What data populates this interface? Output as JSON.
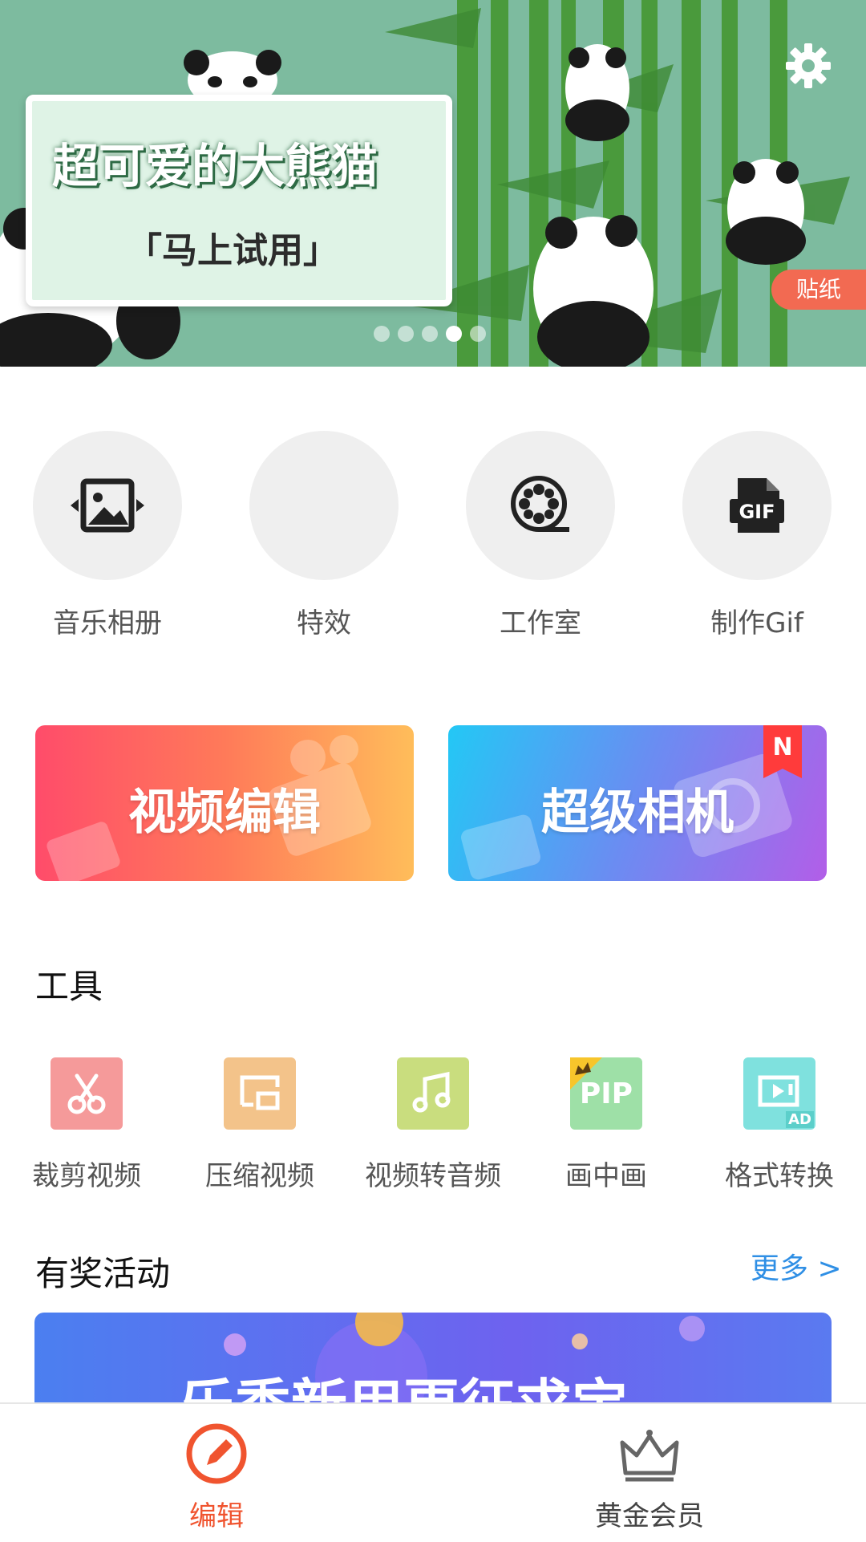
{
  "banner": {
    "title": "超可爱的大熊猫",
    "subtitle": "「马上试用」",
    "tag": "贴纸",
    "settings_icon": "gear-icon",
    "page_count": 5,
    "active_page": 4
  },
  "quick_actions": [
    {
      "label": "音乐相册",
      "icon": "photo-slides-icon"
    },
    {
      "label": "特效",
      "icon": ""
    },
    {
      "label": "工作室",
      "icon": "film-reel-icon"
    },
    {
      "label": "制作Gif",
      "icon": "gif-file-icon"
    }
  ],
  "feature_cards": {
    "video_edit": "视频编辑",
    "camera": "超级相机",
    "new_badge": "N"
  },
  "tools": {
    "title": "工具",
    "items": [
      {
        "label": "裁剪视频",
        "icon": "scissors-icon",
        "color": "#f59a9a"
      },
      {
        "label": "压缩视频",
        "icon": "compress-icon",
        "color": "#f3c38a"
      },
      {
        "label": "视频转音频",
        "icon": "music-note-icon",
        "color": "#c9dd7e"
      },
      {
        "label": "画中画",
        "icon": "pip-icon",
        "color": "#9ee0a7",
        "icon_text": "PIP"
      },
      {
        "label": "格式转换",
        "icon": "video-convert-icon",
        "color": "#7fe1de",
        "icon_text": "AD"
      }
    ]
  },
  "activities": {
    "title": "有奖活动",
    "more": "更多 >",
    "promo_text": "乐秀新用更征求宝"
  },
  "bottom_nav": {
    "edit": "编辑",
    "vip": "黄金会员",
    "active_color": "#f0542f"
  }
}
